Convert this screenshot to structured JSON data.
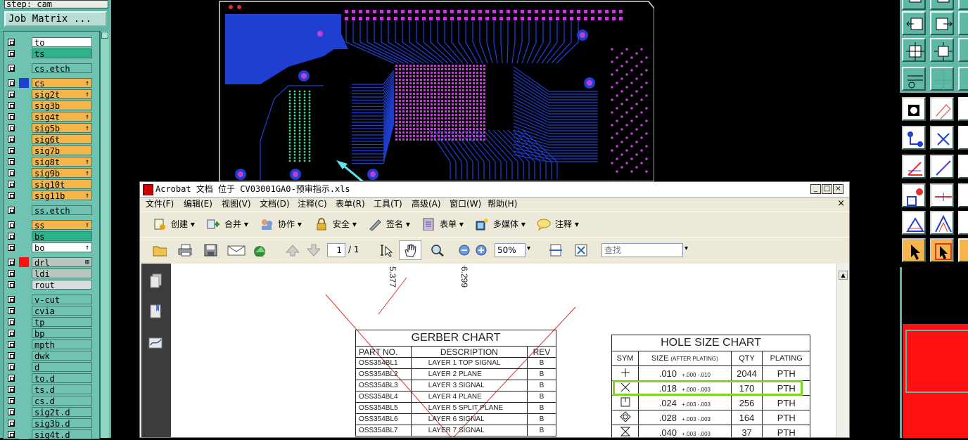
{
  "left_panel": {
    "step_label": "step: cam",
    "job_matrix_button": "Job Matrix ...",
    "layers": [
      {
        "name": "to",
        "bg": "#ffffff",
        "color": "#6fc3b0",
        "flag": ""
      },
      {
        "name": "ts",
        "bg": "#2db38b",
        "color": "#6fc3b0",
        "flag": ""
      },
      {
        "name": "cs.etch",
        "bg": "#6fc3b0",
        "color": "#6fc3b0",
        "flag": ""
      },
      {
        "name": "cs",
        "bg": "#f5b54a",
        "color": "#1f3fd0",
        "flag": "↑"
      },
      {
        "name": "sig2t",
        "bg": "#f5b54a",
        "color": "#6fc3b0",
        "flag": "↑"
      },
      {
        "name": "sig3b",
        "bg": "#f5b54a",
        "color": "#6fc3b0",
        "flag": ""
      },
      {
        "name": "sig4t",
        "bg": "#f5b54a",
        "color": "#6fc3b0",
        "flag": "↑"
      },
      {
        "name": "sig5b",
        "bg": "#f5b54a",
        "color": "#6fc3b0",
        "flag": "↑"
      },
      {
        "name": "sig6t",
        "bg": "#f5b54a",
        "color": "#6fc3b0",
        "flag": ""
      },
      {
        "name": "sig7b",
        "bg": "#f5b54a",
        "color": "#6fc3b0",
        "flag": ""
      },
      {
        "name": "sig8t",
        "bg": "#f5b54a",
        "color": "#6fc3b0",
        "flag": "↑"
      },
      {
        "name": "sig9b",
        "bg": "#f5b54a",
        "color": "#6fc3b0",
        "flag": "↑"
      },
      {
        "name": "sig10t",
        "bg": "#f5b54a",
        "color": "#6fc3b0",
        "flag": ""
      },
      {
        "name": "sig11b",
        "bg": "#f5b54a",
        "color": "#6fc3b0",
        "flag": "↑"
      },
      {
        "name": "ss.etch",
        "bg": "#6fc3b0",
        "color": "#6fc3b0",
        "flag": ""
      },
      {
        "name": "ss",
        "bg": "#f5b54a",
        "color": "#6fc3b0",
        "flag": "↑"
      },
      {
        "name": "bs",
        "bg": "#2db38b",
        "color": "#6fc3b0",
        "flag": ""
      },
      {
        "name": "bo",
        "bg": "#ffffff",
        "color": "#6fc3b0",
        "flag": "↑"
      },
      {
        "name": "drl",
        "bg": "#b9c7c2",
        "color": "#ff1010",
        "flag": "⊞"
      },
      {
        "name": "ldi",
        "bg": "#b9c7c2",
        "color": "#6fc3b0",
        "flag": ""
      },
      {
        "name": "rout",
        "bg": "#d8dedb",
        "color": "#6fc3b0",
        "flag": ""
      },
      {
        "name": "v-cut",
        "bg": "#6fc3b0",
        "color": "#6fc3b0",
        "flag": ""
      },
      {
        "name": "cvia",
        "bg": "#6fc3b0",
        "color": "#6fc3b0",
        "flag": ""
      },
      {
        "name": "tp",
        "bg": "#6fc3b0",
        "color": "#6fc3b0",
        "flag": ""
      },
      {
        "name": "bp",
        "bg": "#6fc3b0",
        "color": "#6fc3b0",
        "flag": ""
      },
      {
        "name": "mpth",
        "bg": "#6fc3b0",
        "color": "#6fc3b0",
        "flag": ""
      },
      {
        "name": "dwk",
        "bg": "#6fc3b0",
        "color": "#6fc3b0",
        "flag": ""
      },
      {
        "name": "d",
        "bg": "#6fc3b0",
        "color": "#6fc3b0",
        "flag": ""
      },
      {
        "name": "to.d",
        "bg": "#6fc3b0",
        "color": "#6fc3b0",
        "flag": ""
      },
      {
        "name": "ts.d",
        "bg": "#6fc3b0",
        "color": "#6fc3b0",
        "flag": ""
      },
      {
        "name": "cs.d",
        "bg": "#6fc3b0",
        "color": "#6fc3b0",
        "flag": ""
      },
      {
        "name": "sig2t.d",
        "bg": "#6fc3b0",
        "color": "#6fc3b0",
        "flag": ""
      },
      {
        "name": "sig3b.d",
        "bg": "#6fc3b0",
        "color": "#6fc3b0",
        "flag": ""
      },
      {
        "name": "sig4t.d",
        "bg": "#6fc3b0",
        "color": "#6fc3b0",
        "flag": ""
      }
    ]
  },
  "acrobat": {
    "title": "Acrobat 文档 位于 CV03001GA0-预审指示.xls",
    "window_buttons": {
      "minimize": "_",
      "maximize": "□",
      "close": "×"
    },
    "menu_close": "×",
    "menu": [
      "文件(F)",
      "编辑(E)",
      "视图(V)",
      "文档(D)",
      "注释(C)",
      "表单(R)",
      "工具(T)",
      "高级(A)",
      "窗口(W)",
      "帮助(H)"
    ],
    "toolbar1": [
      {
        "label": "创建",
        "icon": "create-pdf-icon"
      },
      {
        "label": "合并",
        "icon": "combine-icon"
      },
      {
        "label": "协作",
        "icon": "collaborate-icon"
      },
      {
        "label": "安全",
        "icon": "lock-icon"
      },
      {
        "label": "签名",
        "icon": "pen-icon"
      },
      {
        "label": "表单",
        "icon": "form-icon"
      },
      {
        "label": "多媒体",
        "icon": "multimedia-icon"
      },
      {
        "label": "注释",
        "icon": "comment-icon"
      }
    ],
    "page_current": "1",
    "page_total": "/ 1",
    "zoom": "50%",
    "search_placeholder": "查找",
    "doc": {
      "rot_labels": [
        "5.377",
        "6.299"
      ],
      "gerber_chart": {
        "title": "GERBER CHART",
        "headers": [
          "PART NO.",
          "DESCRIPTION",
          "REV"
        ],
        "rows": [
          [
            "OSS354BL1",
            "LAYER 1 TOP SIGNAL",
            "B"
          ],
          [
            "OSS354BL2",
            "LAYER 2 PLANE",
            "B"
          ],
          [
            "OSS354BL3",
            "LAYER 3 SIGNAL",
            "B"
          ],
          [
            "OSS354BL4",
            "LAYER 4 PLANE",
            "B"
          ],
          [
            "OSS354BL5",
            "LAYER 5 SPLIT PLANE",
            "B"
          ],
          [
            "OSS354BL6",
            "LAYER 6 SIGNAL",
            "B"
          ],
          [
            "OSS354BL7",
            "LAYER 7 SIGNAL",
            "B"
          ]
        ]
      },
      "hole_size_chart": {
        "title": "HOLE SIZE CHART",
        "headers": [
          "SYM",
          "SIZE",
          "(AFTER PLATING)",
          "QTY",
          "PLATING"
        ],
        "rows": [
          {
            "sym": "plus",
            "size": ".010",
            "tol": "+.000 -.010",
            "qty": "2044",
            "plating": "PTH"
          },
          {
            "sym": "x",
            "size": ".018",
            "tol": "+.000 -.003",
            "qty": "170",
            "plating": "PTH"
          },
          {
            "sym": "square",
            "size": ".024",
            "tol": "+.003 -.003",
            "qty": "256",
            "plating": "PTH"
          },
          {
            "sym": "diamond",
            "size": ".028",
            "tol": "+.003 -.003",
            "qty": "164",
            "plating": "PTH"
          },
          {
            "sym": "hourglass",
            "size": ".040",
            "tol": "+.003 -.003",
            "qty": "37",
            "plating": "PTH"
          }
        ],
        "highlight_color": "#7ed321"
      }
    }
  },
  "colors": {
    "panel_teal": "#5fb8a5",
    "pcb_blue": "#1f3fd0",
    "pcb_pad_magenta": "#c23cd6",
    "pcb_green_pads": "#3fd38a",
    "annotation_arrow": "#5ee3e8"
  }
}
